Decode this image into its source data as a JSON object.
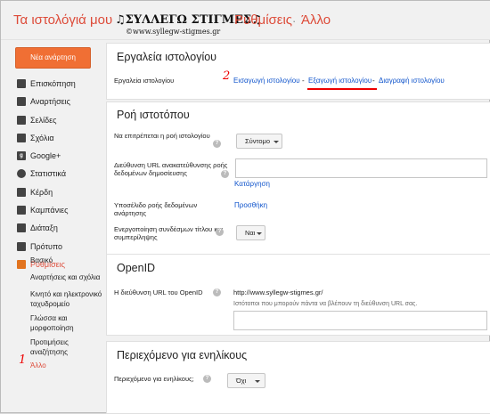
{
  "header": {
    "breadcrumb_link": "Τα ιστολόγιά μου",
    "blog_name": "♫ΣΥΛΛΕΓΩ ΣΤΙΓΜΕΣ♫",
    "separator": "·",
    "settings": "Ρυθμίσεις",
    "current": "Άλλο",
    "subtitle": "©www.syllegw-stigmes.gr"
  },
  "sidebar": {
    "new_post": "Νέα ανάρτηση",
    "items": [
      {
        "label": "Επισκόπηση",
        "icon": "house-icon"
      },
      {
        "label": "Αναρτήσεις",
        "icon": "document-icon"
      },
      {
        "label": "Σελίδες",
        "icon": "page-icon"
      },
      {
        "label": "Σχόλια",
        "icon": "comment-icon"
      },
      {
        "label": "Google+",
        "icon": "google-plus-icon"
      },
      {
        "label": "Στατιστικά",
        "icon": "pie-chart-icon"
      },
      {
        "label": "Κέρδη",
        "icon": "trophy-icon"
      },
      {
        "label": "Καμπάνιες",
        "icon": "megaphone-icon"
      },
      {
        "label": "Διάταξη",
        "icon": "layout-icon"
      },
      {
        "label": "Πρότυπο",
        "icon": "template-icon"
      },
      {
        "label": "Ρυθμίσεις",
        "icon": "wrench-icon"
      }
    ],
    "sub_items": [
      "Βασικό",
      "Αναρτήσεις και σχόλια",
      "Κινητό και ηλεκτρονικό ταχυδρομείο",
      "Γλώσσα και μορφοποίηση",
      "Προτιμήσεις αναζήτησης",
      "Άλλο"
    ],
    "annotation": "1"
  },
  "main": {
    "tools": {
      "title": "Εργαλεία ιστολογίου",
      "label": "Εργαλεία ιστολογίου",
      "annotation": "2",
      "import": "Εισαγωγή ιστολογίου",
      "dash": "-",
      "export": "Εξαγωγή ιστολογίου",
      "delete": "Διαγραφή ιστολογίου"
    },
    "feed": {
      "title": "Ροή ιστοτόπου",
      "allow_label": "Να επιτρέπεται η ροή ιστολογίου",
      "allow_value": "Σύντομο",
      "redirect_label": "Διεύθυνση URL ανακατεύθυνσης ροής δεδομένων δημοσίευσης",
      "remove_link": "Κατάργηση",
      "footer_label": "Υποσέλιδο ροής δεδομένων ανάρτησης",
      "add_link": "Προσθήκη",
      "title_links_label": "Ενεργοποίηση συνδέσμων τίτλου και συμπερίληψης",
      "title_links_value": "Ναι"
    },
    "openid": {
      "title": "OpenID",
      "label": "Η διεύθυνση URL του OpenID",
      "url": "http://www.syllegw-stigmes.gr/",
      "note": "Ιστότοποι που μπορούν πάντα να βλέπουν τη διεύθυνση URL σας."
    },
    "adult": {
      "title": "Περιεχόμενο για ενηλίκους",
      "label": "Περιεχόμενο για ενηλίκους;",
      "value": "Όχι"
    },
    "help_glyph": "?"
  }
}
